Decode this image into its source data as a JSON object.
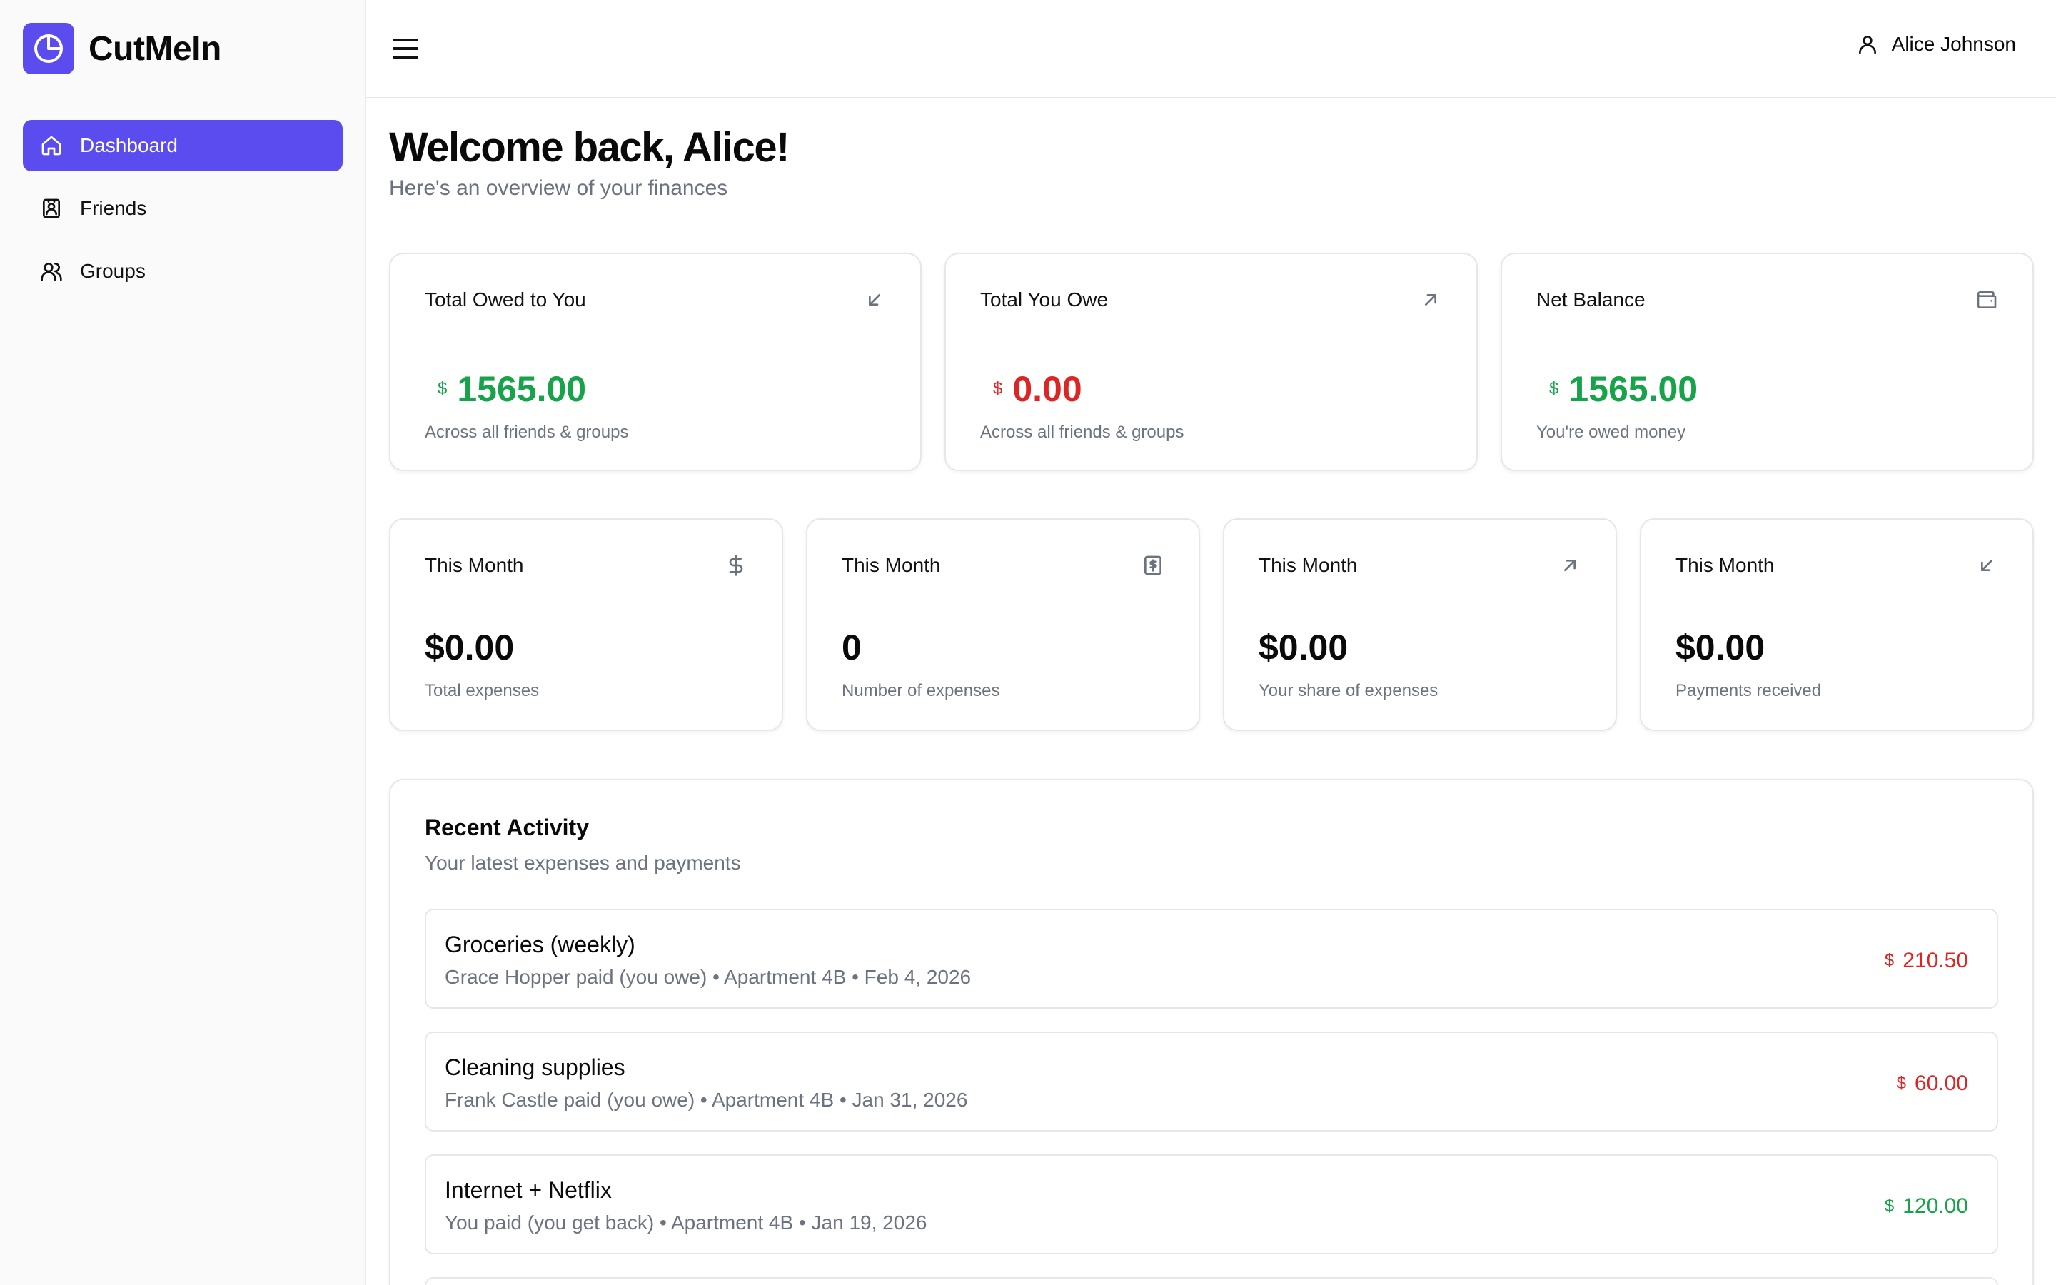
{
  "app": {
    "name": "CutMeIn",
    "brand_color": "#5b4cf0",
    "logo_icon": "pie-chart-icon"
  },
  "sidebar": {
    "items": [
      {
        "label": "Dashboard",
        "icon": "home-icon",
        "active": true
      },
      {
        "label": "Friends",
        "icon": "contact-card-icon",
        "active": false
      },
      {
        "label": "Groups",
        "icon": "users-icon",
        "active": false
      }
    ]
  },
  "header": {
    "menu_icon": "hamburger-menu-icon",
    "user_name": "Alice Johnson",
    "user_icon": "user-icon"
  },
  "main": {
    "title": "Welcome back, Alice!",
    "subtitle": "Here's an overview of your finances",
    "summary_cards": [
      {
        "title": "Total Owed to You",
        "currency": "$",
        "value": "1565.00",
        "caption": "Across all friends & groups",
        "icon": "arrow-down-left-icon",
        "color": "#16a34a"
      },
      {
        "title": "Total You Owe",
        "currency": "$",
        "value": "0.00",
        "caption": "Across all friends & groups",
        "icon": "arrow-up-right-icon",
        "color": "#dc2626"
      },
      {
        "title": "Net Balance",
        "currency": "$",
        "value": "1565.00",
        "caption": "You're owed money",
        "icon": "wallet-icon",
        "color": "#16a34a"
      }
    ],
    "month_cards": [
      {
        "title": "This Month",
        "value": "$0.00",
        "caption": "Total expenses",
        "icon": "dollar-icon"
      },
      {
        "title": "This Month",
        "value": "0",
        "caption": "Number of expenses",
        "icon": "receipt-icon"
      },
      {
        "title": "This Month",
        "value": "$0.00",
        "caption": "Your share of expenses",
        "icon": "arrow-up-right-icon"
      },
      {
        "title": "This Month",
        "value": "$0.00",
        "caption": "Payments received",
        "icon": "arrow-down-left-icon"
      }
    ],
    "activity": {
      "title": "Recent Activity",
      "subtitle": "Your latest expenses and payments",
      "items": [
        {
          "title": "Groceries (weekly)",
          "meta": "Grace Hopper paid (you owe) • Apartment 4B • Feb 4, 2026",
          "currency": "$",
          "amount": "210.50",
          "color": "#dc2626"
        },
        {
          "title": "Cleaning supplies",
          "meta": "Frank Castle paid (you owe) • Apartment 4B • Jan 31, 2026",
          "currency": "$",
          "amount": "60.00",
          "color": "#dc2626"
        },
        {
          "title": "Internet + Netflix",
          "meta": "You paid (you get back) • Apartment 4B • Jan 19, 2026",
          "currency": "$",
          "amount": "120.00",
          "color": "#16a34a"
        }
      ]
    }
  }
}
